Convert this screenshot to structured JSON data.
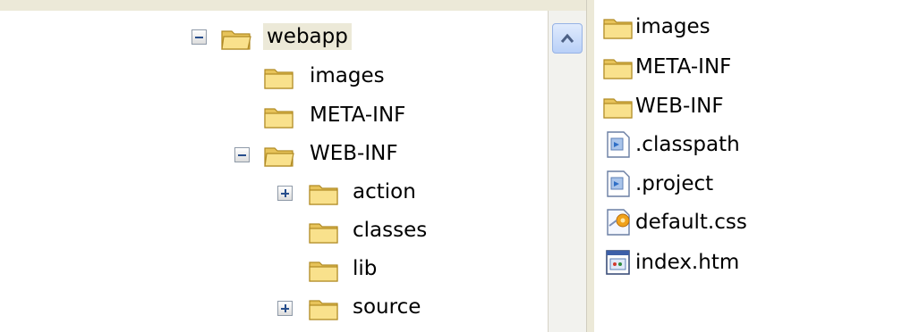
{
  "tree": {
    "nodes": [
      {
        "name": "webapp",
        "expanded": true,
        "selected": true
      },
      {
        "name": "images"
      },
      {
        "name": "META-INF"
      },
      {
        "name": "WEB-INF",
        "expanded": true
      },
      {
        "name": "action",
        "expanded": false
      },
      {
        "name": "classes"
      },
      {
        "name": "lib"
      },
      {
        "name": "source",
        "expanded": false
      }
    ]
  },
  "files": {
    "items": [
      {
        "name": "images",
        "icon": "folder-icon"
      },
      {
        "name": "META-INF",
        "icon": "folder-icon"
      },
      {
        "name": "WEB-INF",
        "icon": "folder-icon"
      },
      {
        "name": ".classpath",
        "icon": "file-icon"
      },
      {
        "name": ".project",
        "icon": "file-icon"
      },
      {
        "name": "default.css",
        "icon": "css-file-icon"
      },
      {
        "name": "index.htm",
        "icon": "html-file-icon"
      }
    ]
  }
}
